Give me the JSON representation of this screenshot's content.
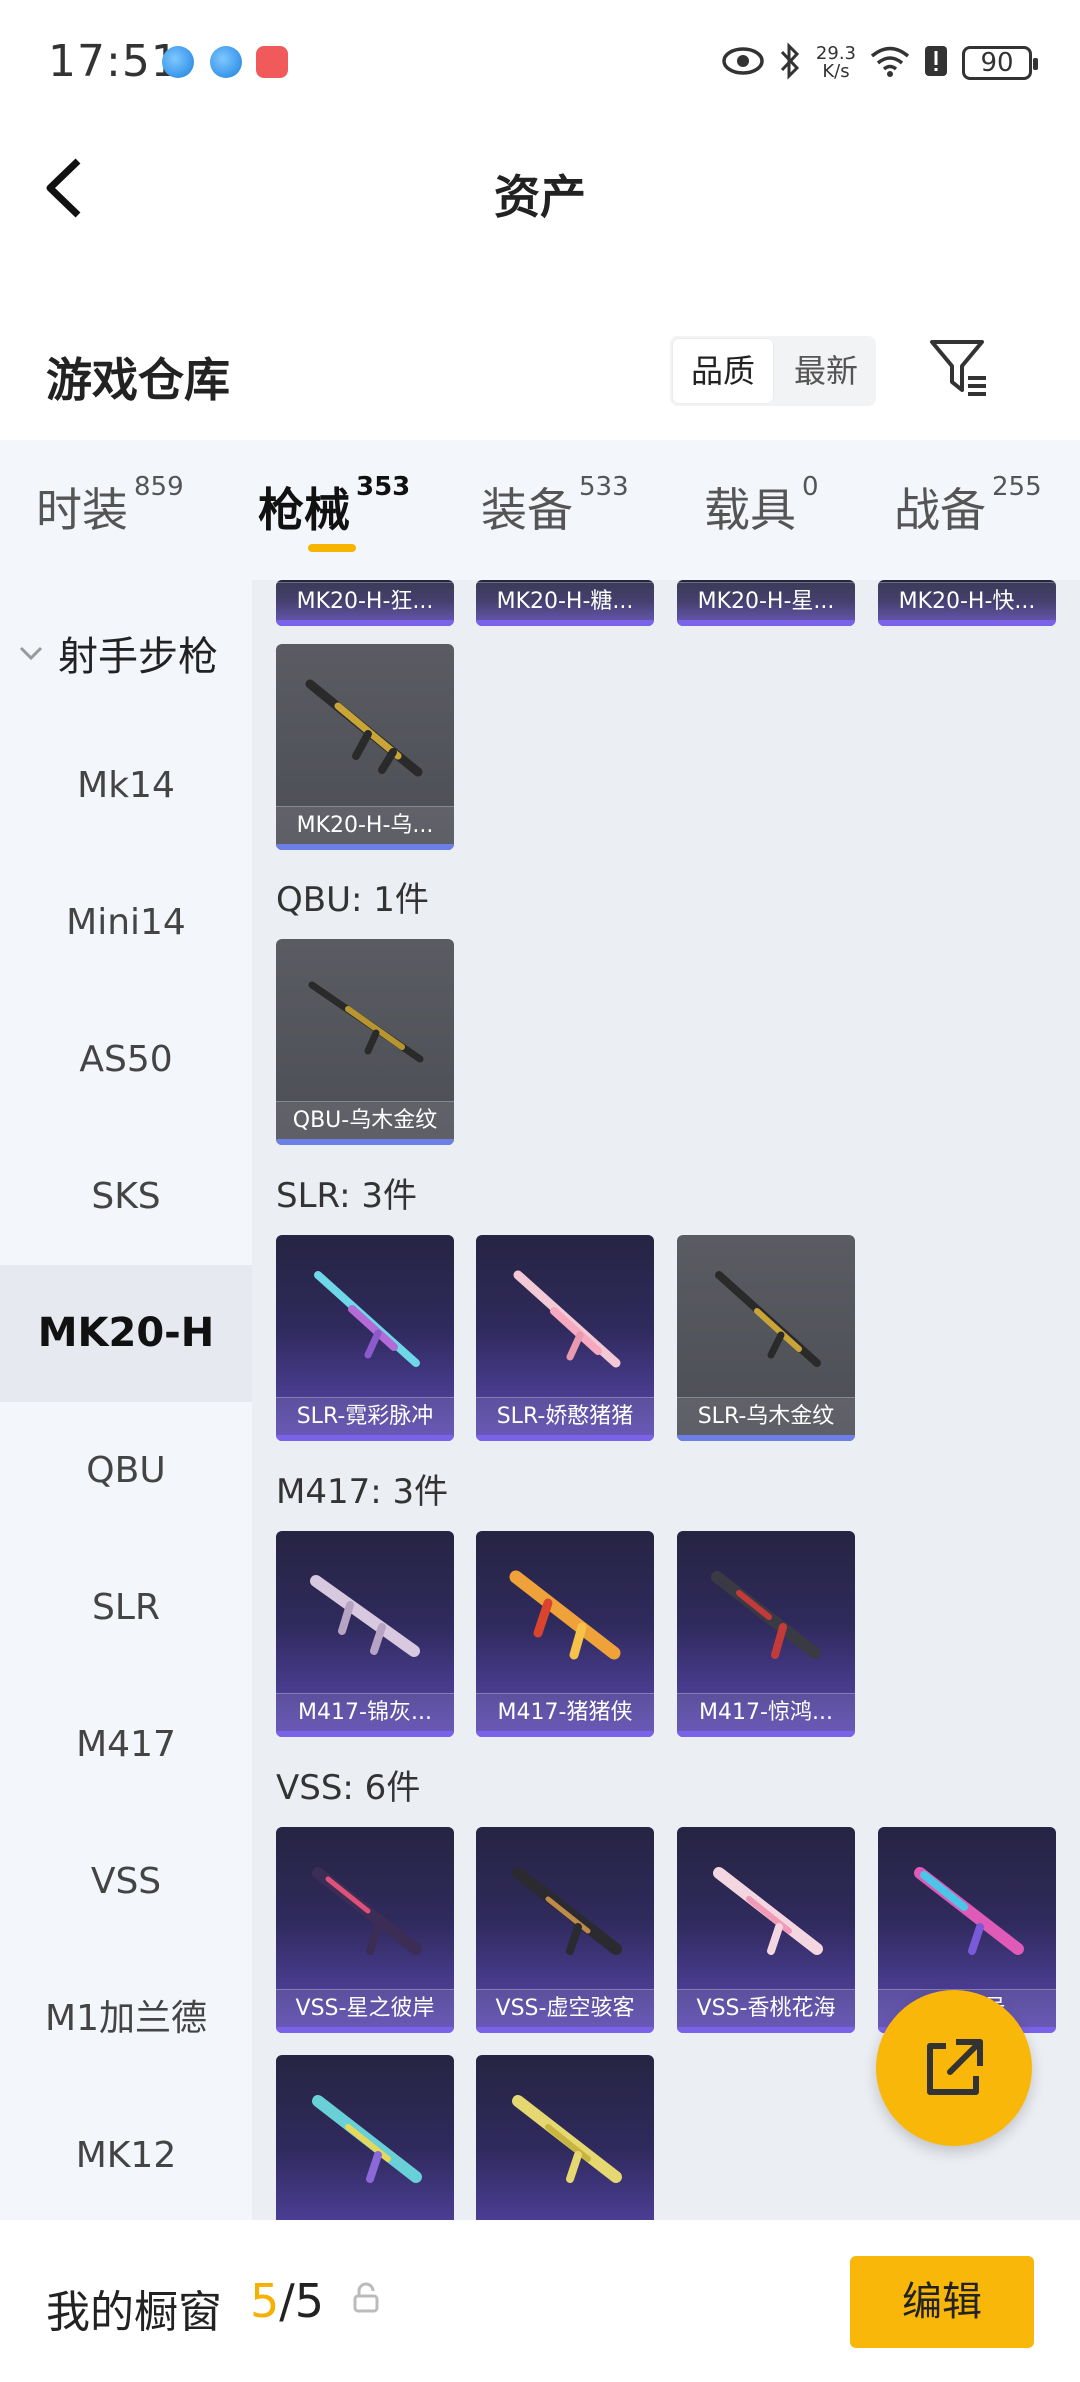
{
  "status_bar": {
    "time": "17:51",
    "speed_top": "29.3",
    "speed_bottom": "K/s",
    "battery": "90",
    "icons": [
      "eye-icon",
      "bluetooth-icon",
      "wifi-icon",
      "alert-icon",
      "battery-icon"
    ]
  },
  "nav": {
    "title": "资产",
    "back_icon": "chevron-left-icon"
  },
  "section": {
    "title": "游戏仓库",
    "sort_options": [
      "品质",
      "最新"
    ],
    "sort_selected": "品质",
    "filter_icon": "filter-icon"
  },
  "tabs": [
    {
      "label": "时装",
      "count": "859"
    },
    {
      "label": "枪械",
      "count": "353"
    },
    {
      "label": "装备",
      "count": "533"
    },
    {
      "label": "载具",
      "count": "0"
    },
    {
      "label": "战备",
      "count": "255"
    }
  ],
  "active_tab": "枪械",
  "sidebar": {
    "category": "射手步枪",
    "items": [
      "Mk14",
      "Mini14",
      "AS50",
      "SKS",
      "MK20-H",
      "QBU",
      "SLR",
      "M417",
      "VSS",
      "M1加兰德",
      "MK12"
    ],
    "active_item": "MK20-H"
  },
  "groups": {
    "mk20_top_row": [
      "MK20-H-狂...",
      "MK20-H-糖...",
      "MK20-H-星...",
      "MK20-H-快..."
    ],
    "mk20_extra": [
      "MK20-H-乌..."
    ],
    "qbu": {
      "label": "QBU: 1件",
      "items": [
        "QBU-乌木金纹"
      ]
    },
    "slr": {
      "label": "SLR: 3件",
      "items": [
        "SLR-霓彩脉冲",
        "SLR-娇憨猪猪",
        "SLR-乌木金纹"
      ]
    },
    "m417": {
      "label": "M417: 3件",
      "items": [
        "M417-锦灰...",
        "M417-猪猪侠",
        "M417-惊鸿..."
      ]
    },
    "vss": {
      "label": "VSS: 6件",
      "items": [
        "VSS-星之彼岸",
        "VSS-虚空骇客",
        "VSS-香桃花海",
        "V...符号",
        "",
        ""
      ]
    }
  },
  "fab_icon": "share-icon",
  "bottom": {
    "label": "我的橱窗",
    "count_current": "5",
    "count_total": "/5",
    "lock_icon": "lock-icon",
    "edit_label": "编辑"
  },
  "colors": {
    "accent": "#f9b70a",
    "purple_card": "#5b48b2",
    "grey_card": "#54565c"
  }
}
